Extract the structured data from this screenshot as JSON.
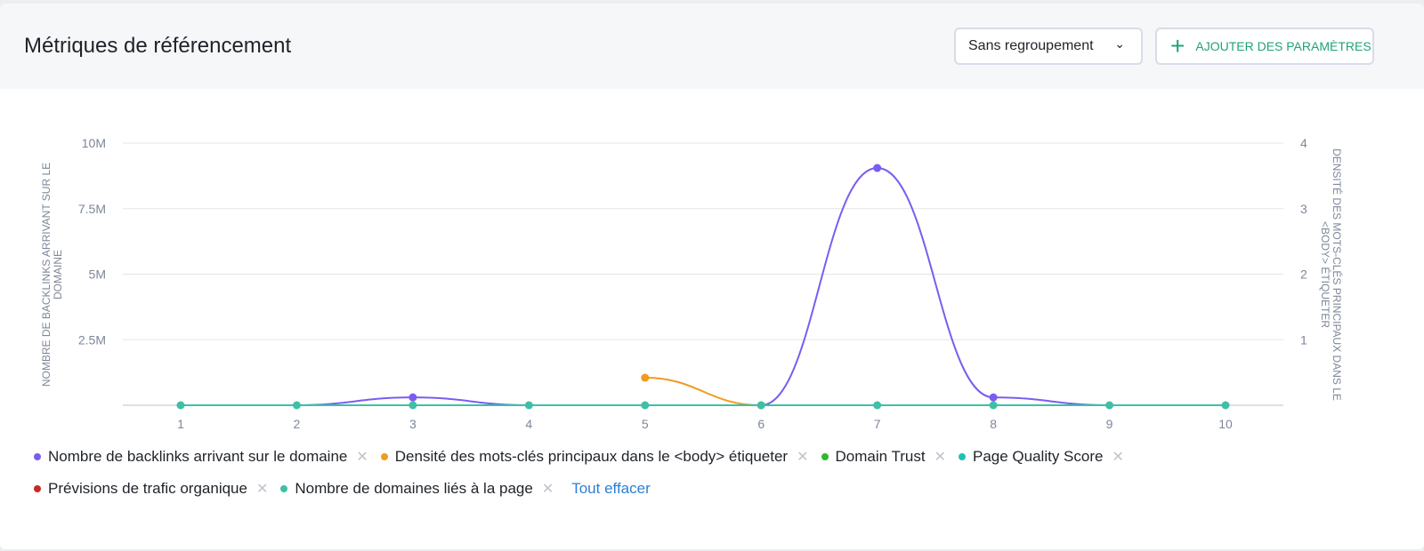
{
  "header": {
    "title": "Métriques de référencement",
    "grouping_label": "Sans regroupement",
    "add_params_label": "AJOUTER DES PARAMÈTRES"
  },
  "chart_data": {
    "type": "line",
    "x": [
      1,
      2,
      3,
      4,
      5,
      6,
      7,
      8,
      9,
      10
    ],
    "ylabel_left": "NOMBRE DE BACKLINKS ARRIVANT SUR LE DOMAINE",
    "ylabel_right": "DENSITÉ DES MOTS-CLÉS PRINCIPAUX DANS LE <BODY> ÉTIQUETER",
    "y_left_ticks": [
      "10M",
      "7.5M",
      "5M",
      "2.5M"
    ],
    "y_left_tick_values": [
      10000000,
      7500000,
      5000000,
      2500000
    ],
    "y_right_ticks": [
      "4",
      "3",
      "2",
      "1"
    ],
    "y_right_tick_values": [
      4,
      3,
      2,
      1
    ],
    "ylim_left": [
      0,
      10000000
    ],
    "ylim_right": [
      0,
      4
    ],
    "grid": true,
    "legend_position": "bottom",
    "series": [
      {
        "name": "Nombre de backlinks arrivant sur le domaine",
        "color": "#7b5cf0",
        "axis": "left",
        "values": [
          0,
          0,
          300000,
          0,
          null,
          0,
          9050000,
          300000,
          0,
          0
        ]
      },
      {
        "name": "Densité des mots-clés principaux dans le <body> étiqueter",
        "color": "#f29a1f",
        "axis": "right",
        "values": [
          null,
          null,
          null,
          null,
          0.42,
          0,
          null,
          null,
          null,
          null
        ]
      },
      {
        "name": "Domain Trust",
        "color": "#2eb82e",
        "axis": "left",
        "values": []
      },
      {
        "name": "Page Quality Score",
        "color": "#1fc1b5",
        "axis": "left",
        "values": []
      },
      {
        "name": "Prévisions de trafic organique",
        "color": "#c9281f",
        "axis": "left",
        "values": []
      },
      {
        "name": "Nombre de domaines liés à la page",
        "color": "#3fbfa5",
        "axis": "left",
        "values": [
          0,
          0,
          0,
          0,
          0,
          0,
          0,
          0,
          0,
          0
        ]
      }
    ]
  },
  "legend": {
    "clear_all": "Tout effacer",
    "remove_glyph": "✕"
  }
}
